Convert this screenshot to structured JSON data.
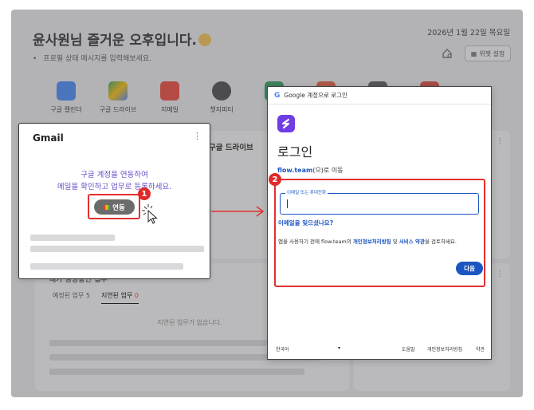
{
  "header": {
    "greeting": "윤사원님 즐거운 오후입니다.",
    "status_placeholder": "프로필 상태 메시지를 입력해보세요.",
    "date": "2026년 1월 22일 목요일",
    "widget_settings": "위젯 설정"
  },
  "apps": [
    {
      "label": "구글 캘린더",
      "color": "#4285f4"
    },
    {
      "label": "구글 드라이브",
      "color": "#34a853"
    },
    {
      "label": "지메일",
      "color": "#ea4335"
    },
    {
      "label": "챗지피티",
      "color": "#444444"
    }
  ],
  "gmail_widget": {
    "title": "Gmail",
    "message_line1": "구글 계정을 연동하여",
    "message_line2": "메일을 확인하고 업무로 등록하세요.",
    "connect_label": "연동",
    "step": "1"
  },
  "drive_widget": {
    "title": "구글 드라이브"
  },
  "tasks_widget": {
    "title": "내가 담당중인 업무",
    "tab_scheduled": "예정된 업무 5",
    "tab_delayed": "지연된 업무",
    "tab_delayed_count": "0",
    "empty": "지연된 업무가 없습니다."
  },
  "google_signin": {
    "window_title": "Google 계정으로 로그인",
    "heading": "로그인",
    "target_link": "flow.team",
    "target_suffix": "(으)로 이동",
    "field_label": "이메일 또는 휴대전화",
    "forgot": "이메일을 잊으셨나요?",
    "policy_prefix": "앱을 사용하기 전에 flow.team의 ",
    "policy_link1": "개인정보처리방침",
    "policy_mid": " 및 ",
    "policy_link2": "서비스 약관",
    "policy_suffix": "을 검토하세요.",
    "next": "다음",
    "step": "2",
    "footer": {
      "language": "한국어",
      "help": "도움말",
      "privacy": "개인정보처리방침",
      "terms": "약관"
    }
  },
  "colors": {
    "accent": "#1a56c2",
    "highlight": "#e23030",
    "purple_text": "#6a4fc8"
  }
}
